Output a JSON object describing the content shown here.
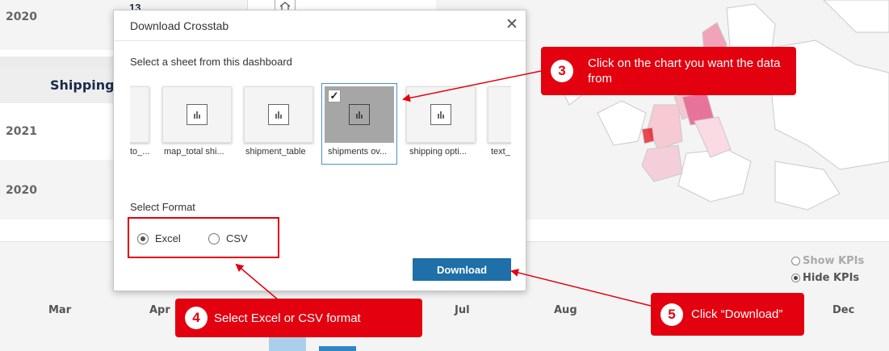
{
  "background": {
    "table": {
      "header": "Shipping",
      "year_top": "2020",
      "value_top": "13",
      "years": [
        "2021",
        "2020"
      ]
    },
    "months": [
      "Mar",
      "Apr",
      "Jul",
      "Aug",
      "Dec"
    ],
    "kpi_toggle": {
      "show": "Show KPIs",
      "hide": "Hide KPIs",
      "selected": "hide"
    }
  },
  "dialog": {
    "title": "Download Crosstab",
    "close_glyph": "✕",
    "sheet_prompt": "Select a sheet from this dashboard",
    "sheets": [
      {
        "label": "to_...",
        "selected": false
      },
      {
        "label": "map_total shi...",
        "selected": false
      },
      {
        "label": "shipment_table",
        "selected": false
      },
      {
        "label": "shipments ov...",
        "selected": true
      },
      {
        "label": "shipping opti...",
        "selected": false
      },
      {
        "label": "text_",
        "selected": false
      }
    ],
    "format_label": "Select Format",
    "formats": [
      {
        "label": "Excel",
        "selected": true
      },
      {
        "label": "CSV",
        "selected": false
      }
    ],
    "download_label": "Download",
    "check_glyph": "✓"
  },
  "annotations": [
    {
      "step": "3",
      "text": "Click on the chart you want the data from"
    },
    {
      "step": "4",
      "text": "Select Excel or CSV format"
    },
    {
      "step": "5",
      "text": "Click “Download”"
    }
  ],
  "colors": {
    "callout": "#e3000f",
    "download_button": "#1f6fa8",
    "selected_thumb": "#a6a6a6",
    "map_highlight": "#e8739a"
  },
  "icons": {
    "chart_thumb": "bar-chart-icon",
    "close": "close-icon",
    "home": "home-icon"
  }
}
